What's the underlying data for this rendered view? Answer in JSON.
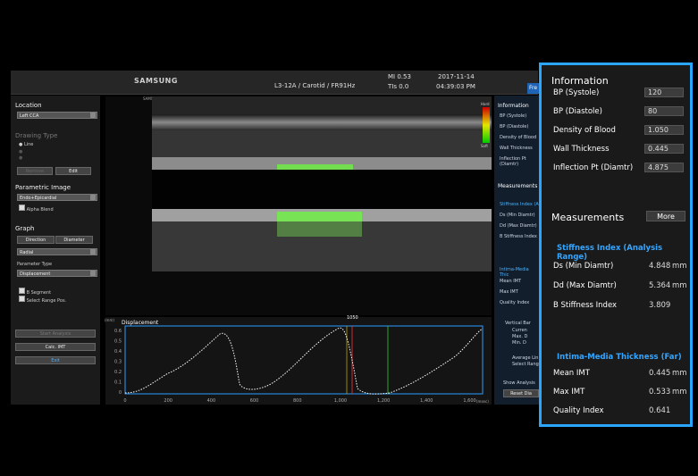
{
  "header": {
    "brand": "SAMSUNG",
    "probe": "L3-12A / Carotid / FR91Hz",
    "mi": "MI  0.53",
    "tis": "TIs  0.0",
    "date": "2017-11-14",
    "time": "04:39:03 PM",
    "tab": "Fre"
  },
  "left": {
    "location_h": "Location",
    "location_val": "Left CCA",
    "drawing_h": "Drawing Type",
    "line": "Line",
    "remove": "Remove",
    "edit": "Edit",
    "param_h": "Parametric Image",
    "param_val": "Endo+Epicardial",
    "alpha": "Alpha Blend",
    "graph_h": "Graph",
    "direction": "Direction",
    "diameter": "Diameter",
    "graph_val": "Radial",
    "ptype_h": "Parameter Type",
    "ptype_val": "Displacement",
    "bseg": "B Segment",
    "selrange": "Select Range Pos.",
    "start": "Start Analysis",
    "calc": "Calc. IMT",
    "exit": "Exit"
  },
  "image": {
    "top_left": "SAMSUNG",
    "colorbar_hard": "Hard",
    "colorbar_soft": "Soft"
  },
  "graph": {
    "title": "Displacement",
    "unit": "(mm)",
    "peak": "1050",
    "xticks": [
      "0",
      "200",
      "400",
      "600",
      "800",
      "1,000",
      "1,200",
      "1,400",
      "1,600"
    ],
    "xunit": "(msec)",
    "yticks": [
      "0.6",
      "0.5",
      "0.4",
      "0.3",
      "0.2",
      "0.1",
      "0"
    ]
  },
  "rpanel": {
    "info": "Information",
    "bps": "BP (Systole)",
    "bpd": "BP (Diastole)",
    "dens": "Density of Blood",
    "wall": "Wall Thickness",
    "infl": "Inflection Pt (Diamtr)",
    "meas": "Measurements",
    "stiff": "Stiffness Index (A",
    "ds": "Ds (Min Diamtr)",
    "dd": "Dd (Max Diamtr)",
    "bstiff": "B Stiffness Index",
    "imt": "Intima-Media Thic",
    "mean": "Mean IMT",
    "max": "Max IMT",
    "qi": "Quality Index",
    "vbar": "Vertical Bar",
    "curr": "Curren",
    "maxd": "Max. D",
    "mind": "Min. D",
    "avg": "Average Lin",
    "selr": "Select Rang",
    "show": "Show Analysis",
    "reset": "Reset Dia"
  },
  "zoom": {
    "info_h": "Information",
    "rows": [
      {
        "label": "BP (Systole)",
        "value": "120"
      },
      {
        "label": "BP (Diastole)",
        "value": "80"
      },
      {
        "label": "Density of Blood",
        "value": "1.050"
      },
      {
        "label": "Wall Thickness",
        "value": "0.445"
      },
      {
        "label": "Inflection Pt (Diamtr)",
        "value": "4.875"
      }
    ],
    "meas_h": "Measurements",
    "more": "More",
    "stiff_h": "Stiffness Index (Analysis Range)",
    "stiff_rows": [
      {
        "label": "Ds (Min Diamtr)",
        "value": "4.848",
        "unit": "mm"
      },
      {
        "label": "Dd (Max Diamtr)",
        "value": "5.364",
        "unit": "mm"
      },
      {
        "label": "B Stiffness Index",
        "value": "3.809",
        "unit": ""
      }
    ],
    "imt_h": "Intima-Media Thickness (Far)",
    "imt_rows": [
      {
        "label": "Mean IMT",
        "value": "0.445",
        "unit": "mm"
      },
      {
        "label": "Max IMT",
        "value": "0.533",
        "unit": "mm"
      },
      {
        "label": "Quality Index",
        "value": "0.641",
        "unit": ""
      }
    ]
  },
  "colors": {
    "accent": "#2aa6ff",
    "highlight_green": "#66ff33"
  }
}
